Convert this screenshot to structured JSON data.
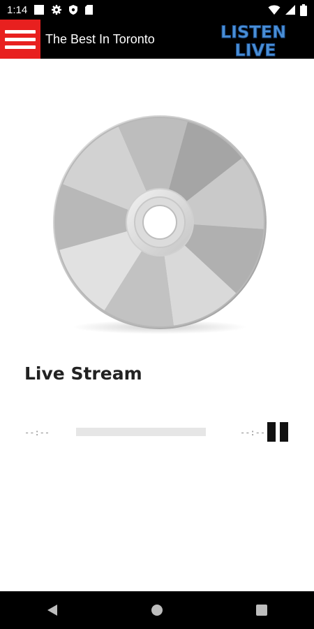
{
  "status_bar": {
    "time": "1:14",
    "icons": [
      "notification-square-icon",
      "gear-icon",
      "shield-icon",
      "sd-card-icon",
      "wifi-icon",
      "signal-icon",
      "battery-icon"
    ]
  },
  "app_bar": {
    "title": "The Best In Toronto",
    "logo_line1": "LISTEN",
    "logo_line2": "LIVE",
    "menu_icon": "hamburger-menu-icon",
    "colors": {
      "bar": "#000000",
      "menu_bg": "#e8201f",
      "logo": "#4a8fd6"
    }
  },
  "player": {
    "artwork": "cd-disc-image",
    "stream_title": "Live Stream",
    "time_elapsed": "--:--",
    "time_remaining": "--:--",
    "progress": 0,
    "control_icon": "pause-icon"
  },
  "nav_bar": {
    "buttons": [
      "back-triangle-icon",
      "home-circle-icon",
      "recents-square-icon"
    ]
  }
}
